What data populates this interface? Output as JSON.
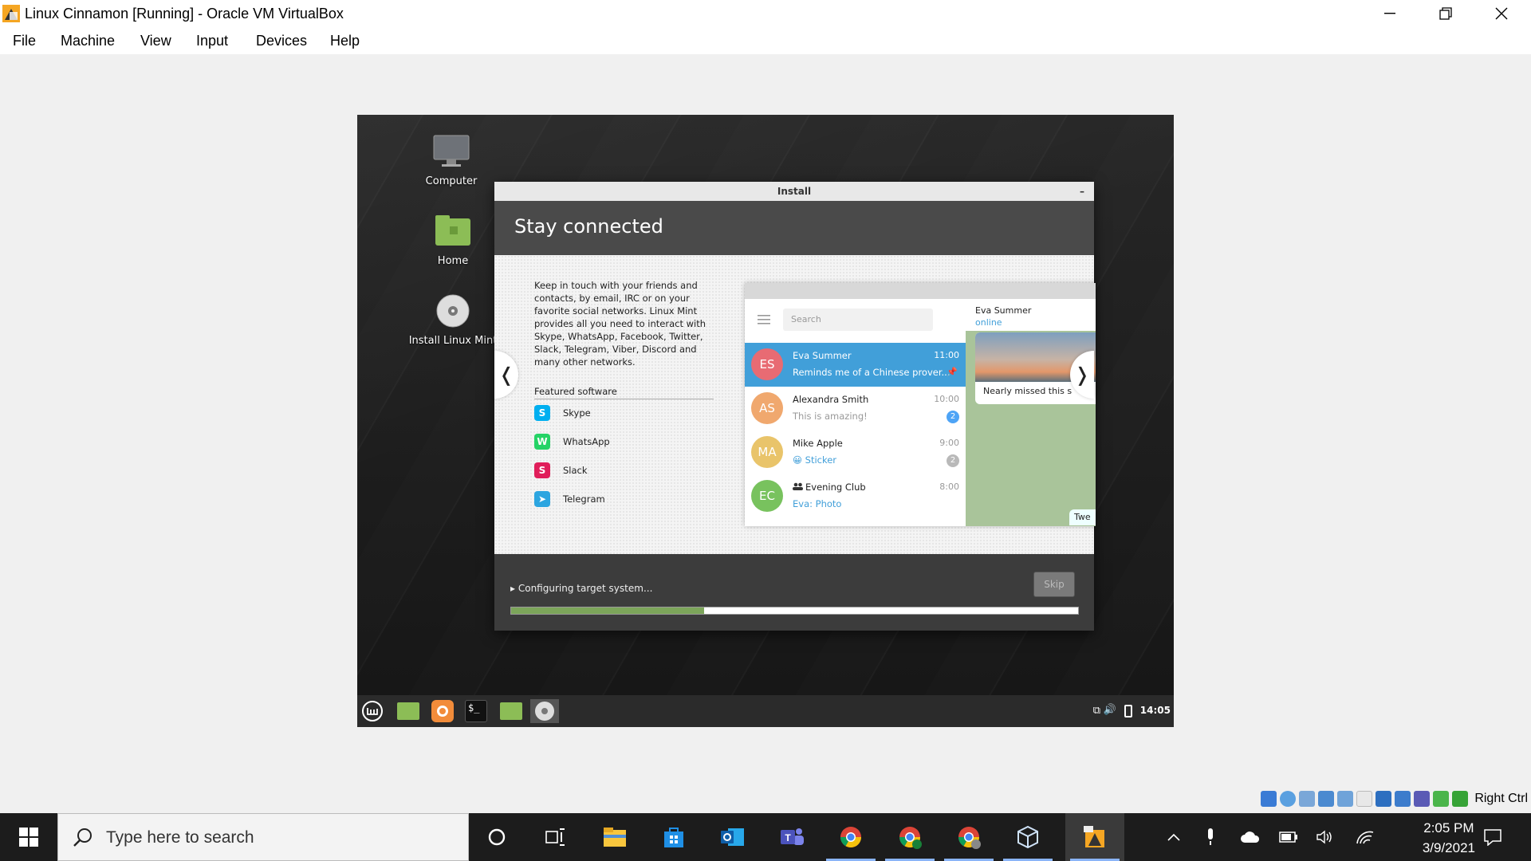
{
  "window": {
    "title": "Linux Cinnamon  [Running] - Oracle VM VirtualBox",
    "menu": [
      "File",
      "Machine",
      "View",
      "Input",
      "Devices",
      "Help"
    ]
  },
  "desktop": {
    "icons": [
      {
        "label": "Computer",
        "icon": "computer-icon"
      },
      {
        "label": "Home",
        "icon": "home-folder-icon"
      },
      {
        "label": "Install Linux Mint",
        "icon": "disc-icon"
      }
    ]
  },
  "installer": {
    "window_title": "Install",
    "minimize": "–",
    "heading": "Stay connected",
    "description": "Keep in touch with your friends and contacts, by email, IRC or on your favorite social networks. Linux Mint provides all you need to interact with Skype, WhatsApp, Facebook, Twitter, Slack, Telegram, Viber, Discord and many other networks.",
    "featured_title": "Featured software",
    "featured": [
      {
        "name": "Skype",
        "icon": "skype-icon",
        "color": "#00aff0",
        "glyph": "S"
      },
      {
        "name": "WhatsApp",
        "icon": "whatsapp-icon",
        "color": "#25d366",
        "glyph": "W"
      },
      {
        "name": "Slack",
        "icon": "slack-icon",
        "color": "#e01e5a",
        "glyph": "S"
      },
      {
        "name": "Telegram",
        "icon": "telegram-icon",
        "color": "#2ca5e0",
        "glyph": "➤"
      }
    ],
    "prev_arrow": "❬",
    "next_arrow": "❭",
    "status": "Configuring target system...",
    "skip": "Skip",
    "progress": 0.34
  },
  "telegram": {
    "search": "Search",
    "contact_name": "Eva Summer",
    "contact_status": "online",
    "image_caption": "Nearly missed this s",
    "bubble": "Twe",
    "chats": [
      {
        "initials": "ES",
        "name": "Eva Summer",
        "time": "11:00",
        "message": "Reminds me of a Chinese prover...",
        "color": "#e86b73",
        "badge": ""
      },
      {
        "initials": "AS",
        "name": "Alexandra Smith",
        "time": "10:00",
        "message": "This is amazing!",
        "color": "#f0a86e",
        "badge": "2"
      },
      {
        "initials": "MA",
        "name": "Mike Apple",
        "time": "9:00",
        "message": "😀 Sticker",
        "color": "#e9c46a",
        "badge": "2"
      },
      {
        "initials": "EC",
        "name": "Evening Club",
        "time": "8:00",
        "message": "Eva: Photo",
        "color": "#78c25e",
        "badge": ""
      }
    ]
  },
  "vm_panel": {
    "time": "14:05"
  },
  "vbox_status": {
    "host_key": "Right Ctrl"
  },
  "taskbar": {
    "search_placeholder": "Type here to search",
    "time": "2:05 PM",
    "date": "3/9/2021"
  }
}
